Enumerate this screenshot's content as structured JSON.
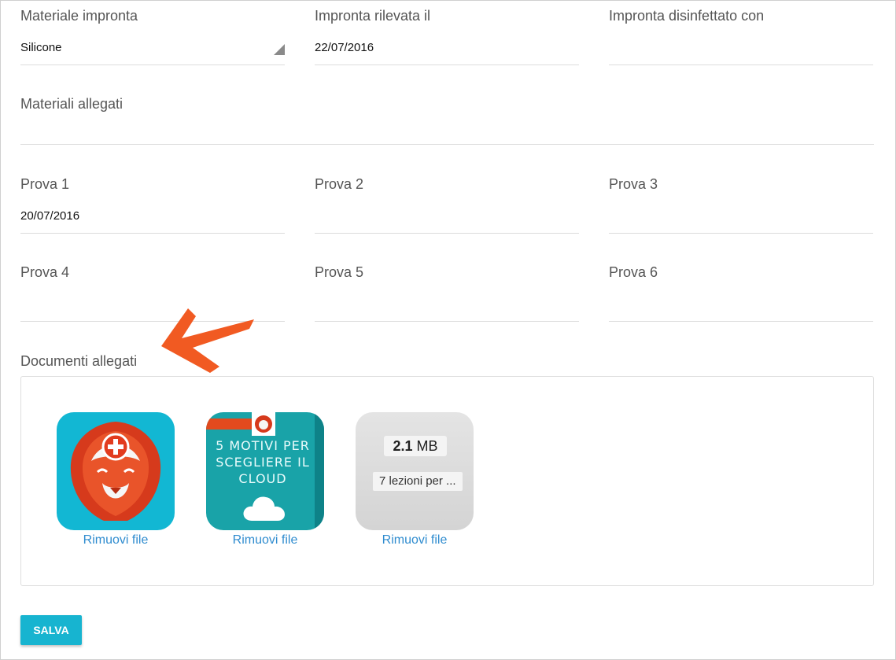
{
  "row1": {
    "materiale": {
      "label": "Materiale impronta",
      "value": "Silicone"
    },
    "rilevata": {
      "label": "Impronta rilevata il",
      "value": "22/07/2016"
    },
    "disinfettato": {
      "label": "Impronta disinfettato con",
      "value": ""
    }
  },
  "materiali_allegati": {
    "label": "Materiali allegati",
    "value": ""
  },
  "prove": [
    {
      "label": "Prova 1",
      "value": "20/07/2016"
    },
    {
      "label": "Prova 2",
      "value": ""
    },
    {
      "label": "Prova 3",
      "value": ""
    },
    {
      "label": "Prova 4",
      "value": ""
    },
    {
      "label": "Prova 5",
      "value": ""
    },
    {
      "label": "Prova 6",
      "value": ""
    }
  ],
  "documents": {
    "label": "Documenti allegati",
    "files": [
      {
        "icon": "lion-logo-icon",
        "remove_label": "Rimuovi file"
      },
      {
        "icon": "cloud-ebook-cover-icon",
        "title": "5 MOTIVI PER SCEGLIERE IL CLOUD",
        "remove_label": "Rimuovi file"
      },
      {
        "icon": "generic-file-icon",
        "size_value": "2.1",
        "size_unit": "MB",
        "name": "7 lezioni per ...",
        "remove_label": "Rimuovi file"
      }
    ]
  },
  "save_label": "SALVA",
  "colors": {
    "accent": "#17b4d0",
    "link": "#2f8ccf",
    "arrow": "#f15a22"
  }
}
